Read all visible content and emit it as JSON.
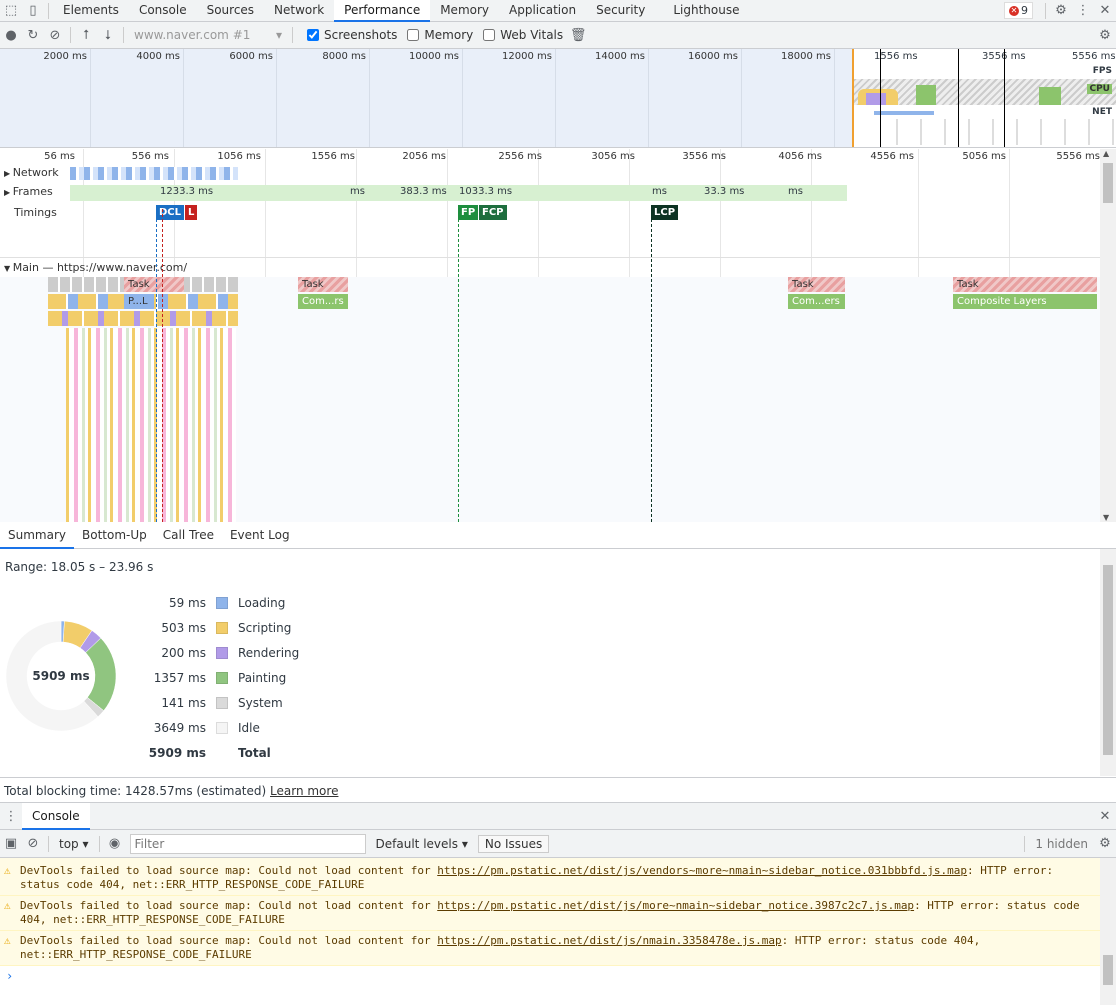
{
  "tabbar": {
    "tabs": [
      "Elements",
      "Console",
      "Sources",
      "Network",
      "Performance",
      "Memory",
      "Application",
      "Security",
      "Lighthouse"
    ],
    "active": "Performance",
    "error_count": "9"
  },
  "toolbar": {
    "profile_select": "www.naver.com #1",
    "screenshots_label": "Screenshots",
    "memory_label": "Memory",
    "webvitals_label": "Web Vitals"
  },
  "overview": {
    "ticks": [
      "2000 ms",
      "4000 ms",
      "6000 ms",
      "8000 ms",
      "10000 ms",
      "12000 ms",
      "14000 ms",
      "16000 ms",
      "18000 ms"
    ],
    "right_ticks": [
      "1556 ms",
      "3556 ms",
      "5556 ms"
    ],
    "fps_label": "FPS",
    "cpu_label": "CPU",
    "net_label": "NET"
  },
  "timeline": {
    "ticks": [
      "56 ms",
      "556 ms",
      "1056 ms",
      "1556 ms",
      "2056 ms",
      "2556 ms",
      "3056 ms",
      "3556 ms",
      "4056 ms",
      "4556 ms",
      "5056 ms",
      "5556 ms"
    ],
    "network_label": "Network",
    "frames_label": "Frames",
    "timings_label": "Timings",
    "main_label": "Main — https://www.naver.com/",
    "frames": [
      "1233.3 ms",
      "ms",
      "383.3 ms",
      "1033.3 ms",
      "ms",
      "33.3 ms",
      "ms"
    ],
    "markers": [
      "DCL",
      "L",
      "FP",
      "FCP",
      "LCP"
    ],
    "tasks": [
      "Task",
      "Task",
      "Task",
      "Task"
    ],
    "composites": [
      "P...L",
      "Com...rs",
      "Com...ers",
      "Composite Layers"
    ]
  },
  "bottom_tabs": [
    "Summary",
    "Bottom-Up",
    "Call Tree",
    "Event Log"
  ],
  "summary": {
    "range": "Range: 18.05 s – 23.96 s",
    "center": "5909 ms",
    "rows": [
      {
        "value": "59 ms",
        "label": "Loading",
        "color": "#8fb4ea"
      },
      {
        "value": "503 ms",
        "label": "Scripting",
        "color": "#f2cd6a"
      },
      {
        "value": "200 ms",
        "label": "Rendering",
        "color": "#b19be8"
      },
      {
        "value": "1357 ms",
        "label": "Painting",
        "color": "#90c580"
      },
      {
        "value": "141 ms",
        "label": "System",
        "color": "#dadada"
      },
      {
        "value": "3649 ms",
        "label": "Idle",
        "color": "#f5f5f5"
      }
    ],
    "total_value": "5909 ms",
    "total_label": "Total",
    "tbt": "Total blocking time: 1428.57ms (estimated)",
    "learn_more": "Learn more"
  },
  "console": {
    "drawer_tab": "Console",
    "context": "top",
    "filter_placeholder": "Filter",
    "levels": "Default levels",
    "issues": "No Issues",
    "hidden": "1 hidden",
    "messages": [
      {
        "pre": "DevTools failed to load source map: Could not load content for ",
        "url": "https://pm.pstatic.net/dist/js/vendors~more~nmain~sidebar_notice.031bbbfd.js.map",
        "post": ": HTTP error: status code 404, net::ERR_HTTP_RESPONSE_CODE_FAILURE"
      },
      {
        "pre": "DevTools failed to load source map: Could not load content for ",
        "url": "https://pm.pstatic.net/dist/js/more~nmain~sidebar_notice.3987c2c7.js.map",
        "post": ": HTTP error: status code 404, net::ERR_HTTP_RESPONSE_CODE_FAILURE"
      },
      {
        "pre": "DevTools failed to load source map: Could not load content for ",
        "url": "https://pm.pstatic.net/dist/js/nmain.3358478e.js.map",
        "post": ": HTTP error: status code 404, net::ERR_HTTP_RESPONSE_CODE_FAILURE"
      }
    ]
  }
}
